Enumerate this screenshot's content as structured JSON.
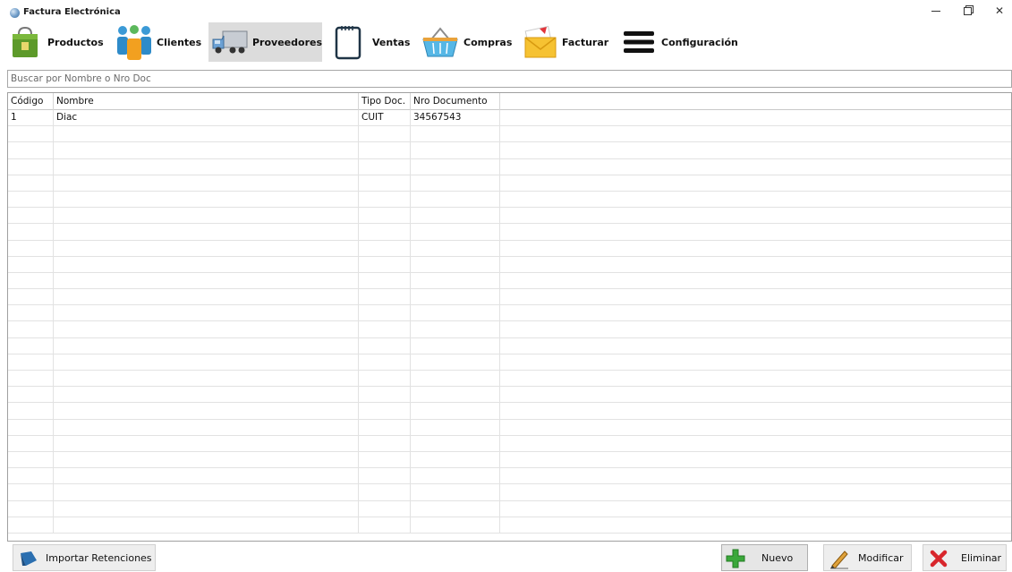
{
  "window": {
    "title": "Factura Electrónica"
  },
  "toolbar": {
    "items": [
      {
        "label": "Productos",
        "icon": "shopping-bag-icon"
      },
      {
        "label": "Clientes",
        "icon": "users-icon"
      },
      {
        "label": "Proveedores",
        "icon": "delivery-truck-icon",
        "active": true
      },
      {
        "label": "Ventas",
        "icon": "notepad-icon"
      },
      {
        "label": "Compras",
        "icon": "shopping-basket-icon"
      },
      {
        "label": "Facturar",
        "icon": "envelope-icon"
      },
      {
        "label": "Configuración",
        "icon": "hamburger-menu-icon"
      }
    ]
  },
  "search": {
    "placeholder": "Buscar por Nombre o Nro Doc",
    "value": ""
  },
  "grid": {
    "columns": [
      "Código",
      "Nombre",
      "Tipo Doc.",
      "Nro Documento"
    ],
    "rows": [
      [
        "1",
        "Diac",
        "CUIT",
        "34567543"
      ]
    ]
  },
  "actions": {
    "import_label": "Importar Retenciones",
    "new_label": "Nuevo",
    "edit_label": "Modificar",
    "delete_label": "Eliminar"
  },
  "colors": {
    "active_tab_bg": "#dcdcdc",
    "grid_line": "#e2e2e2",
    "delete_red": "#d8262c",
    "new_green": "#3aa83a"
  }
}
